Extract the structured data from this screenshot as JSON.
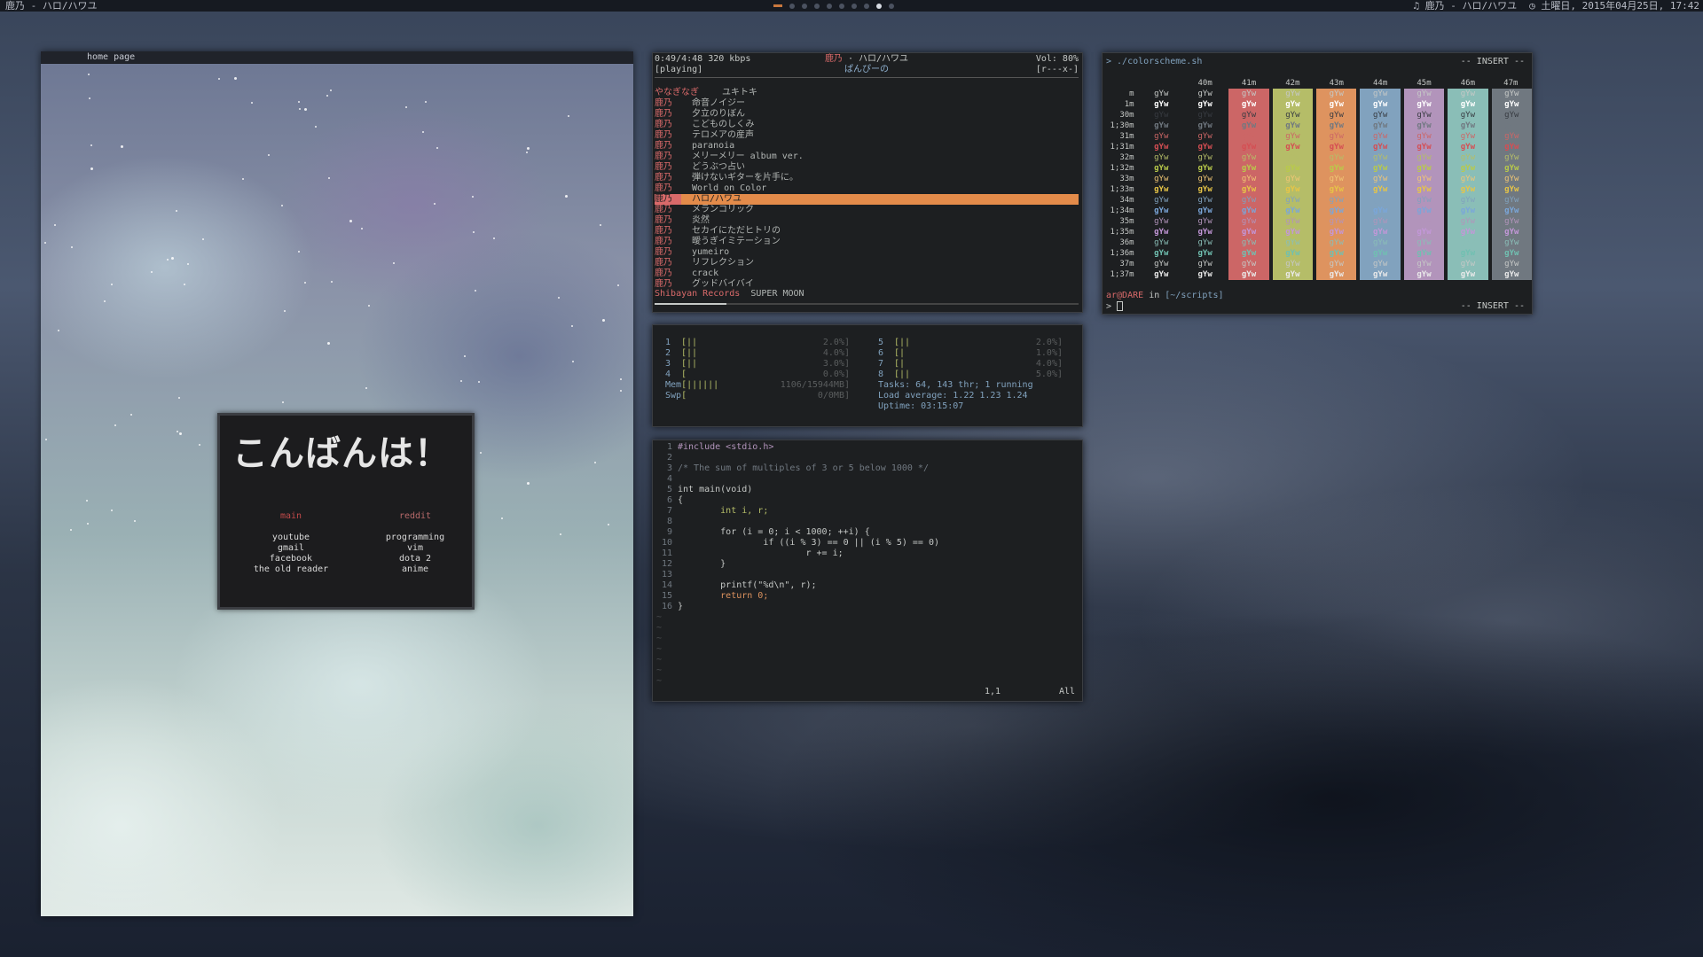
{
  "topbar": {
    "window_title": "鹿乃 - ハロ/ハワユ",
    "now_playing": "♫ 鹿乃 - ハロ/ハワユ",
    "datetime": "◷ 土曜日, 2015年04月25日, 17:42"
  },
  "browser": {
    "title": "home page",
    "greeting": "こんばんは！",
    "columns": [
      {
        "head": "main",
        "links": [
          "youtube",
          "gmail",
          "facebook",
          "the old reader"
        ]
      },
      {
        "head": "reddit",
        "links": [
          "programming",
          "vim",
          "dota 2",
          "anime"
        ]
      }
    ]
  },
  "player": {
    "time": "0:49/4:48 320 kbps",
    "state": "[playing]",
    "artist": "鹿乃",
    "title": "ハロ/ハワユ",
    "album": "ぱんぴーの",
    "volume": "Vol: 80%",
    "flags": "[r---x-]",
    "progress": 0.17,
    "tracks": [
      {
        "artist": "やなぎなぎ",
        "title": "ユキトキ"
      },
      {
        "artist": "鹿乃",
        "title": "命音ノイジー"
      },
      {
        "artist": "鹿乃",
        "title": "夕立のりぼん"
      },
      {
        "artist": "鹿乃",
        "title": "こどものしくみ"
      },
      {
        "artist": "鹿乃",
        "title": "テロメアの産声"
      },
      {
        "artist": "鹿乃",
        "title": "paranoia"
      },
      {
        "artist": "鹿乃",
        "title": "メリーメリー album ver."
      },
      {
        "artist": "鹿乃",
        "title": "どうぶつ占い"
      },
      {
        "artist": "鹿乃",
        "title": "弾けないギターを片手に。"
      },
      {
        "artist": "鹿乃",
        "title": "World on Color"
      },
      {
        "artist": "鹿乃",
        "title": "ハロ/ハワユ",
        "playing": true
      },
      {
        "artist": "鹿乃",
        "title": "メランコリック"
      },
      {
        "artist": "鹿乃",
        "title": "炎然"
      },
      {
        "artist": "鹿乃",
        "title": "セカイにただヒトリの"
      },
      {
        "artist": "鹿乃",
        "title": "曖うぎイミテーション"
      },
      {
        "artist": "鹿乃",
        "title": "yumeiro"
      },
      {
        "artist": "鹿乃",
        "title": "リフレクション"
      },
      {
        "artist": "鹿乃",
        "title": "crack"
      },
      {
        "artist": "鹿乃",
        "title": "グッドバイバイ"
      }
    ],
    "footer_label": "Shibayan Records",
    "footer_album": "SUPER MOON"
  },
  "htop": {
    "cpus": [
      {
        "n": "1",
        "bar": "[||",
        "val": "2.0%]"
      },
      {
        "n": "2",
        "bar": "[||",
        "val": "4.0%]"
      },
      {
        "n": "3",
        "bar": "[||",
        "val": "3.0%]"
      },
      {
        "n": "4",
        "bar": "[",
        "val": "0.0%]"
      },
      {
        "n": "5",
        "bar": "[||",
        "val": "2.0%]"
      },
      {
        "n": "6",
        "bar": "[|",
        "val": "1.0%]"
      },
      {
        "n": "7",
        "bar": "[|",
        "val": "4.0%]"
      },
      {
        "n": "8",
        "bar": "[||",
        "val": "5.0%]"
      }
    ],
    "mem_label": "Mem",
    "mem_bar": "[||||||",
    "mem_val": "1106/15944MB]",
    "swp_label": "Swp",
    "swp_bar": "[",
    "swp_val": "0/0MB]",
    "tasks": "Tasks: 64, 143 thr; 1 running",
    "load": "Load average: 1.22 1.23 1.24",
    "uptime": "Uptime: 03:15:07"
  },
  "vim": {
    "l1": "#include <stdio.h>",
    "l3": "/* The sum of multiples of 3 or 5 below 1000 */",
    "l5": "int main(void)",
    "l6": "{",
    "l7": "        int i, r;",
    "l9": "        for (i = 0; i < 1000; ++i) {",
    "l10": "                if ((i % 3) == 0 || (i % 5) == 0)",
    "l11": "                        r += i;",
    "l12": "        }",
    "l14": "        printf(\"%d\\n\", r);",
    "l15": "        return 0;",
    "l16": "}",
    "pos": "1,1",
    "all": "All"
  },
  "colorscheme": {
    "command": "> ./colorscheme.sh",
    "mode": "-- INSERT --",
    "sample": "gYw",
    "bg_headers": [
      "40m",
      "41m",
      "42m",
      "43m",
      "44m",
      "45m",
      "46m",
      "47m"
    ],
    "bg_colors": [
      "#1d1f21",
      "#cc6666",
      "#b5bd68",
      "#de935f",
      "#81a2be",
      "#b294bb",
      "#8abeb7",
      "#707880"
    ],
    "row_labels": [
      "m",
      "1m",
      "30m",
      "1;30m",
      "31m",
      "1;31m",
      "32m",
      "1;32m",
      "33m",
      "1;33m",
      "34m",
      "1;34m",
      "35m",
      "1;35m",
      "36m",
      "1;36m",
      "37m",
      "1;37m"
    ],
    "fg_colors": [
      "#c5c8c6",
      "#ffffff",
      "#373b41",
      "#707880",
      "#cc6666",
      "#d54e53",
      "#b5bd68",
      "#b9ca4a",
      "#f0c674",
      "#e7c547",
      "#81a2be",
      "#7aa6da",
      "#b294bb",
      "#c397d8",
      "#8abeb7",
      "#70c0b1",
      "#c5c8c6",
      "#eaeaea"
    ],
    "prompt_user": "ar@DARE",
    "prompt_in": "in",
    "prompt_path": "[~/scripts]",
    "prompt_caret": ">"
  }
}
